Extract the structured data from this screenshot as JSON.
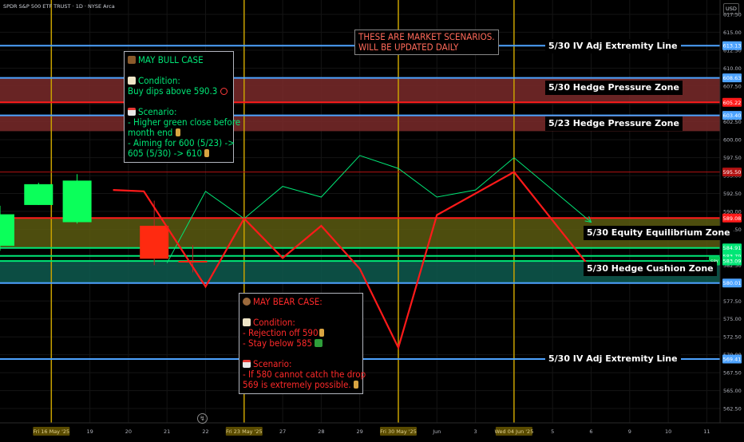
{
  "header": {
    "title": "SPDR S&P 500 ETF TRUST · 1D · NYSE Arca",
    "currency": "USD"
  },
  "colors": {
    "up": "#00e676",
    "down": "#ff1a1a",
    "blue_line": "#4da3ff",
    "gold_vline": "#c8a100",
    "zone_red": "#7a2a2a",
    "zone_olive": "#5a5a10",
    "zone_teal": "#0e5a4f"
  },
  "chart_data": {
    "type": "line",
    "ylim": [
      560.5,
      619.5
    ],
    "y_ticks": [
      617.5,
      615.0,
      612.5,
      610.0,
      607.5,
      605.0,
      602.5,
      600.0,
      597.5,
      595.0,
      592.5,
      590.0,
      587.5,
      585.0,
      582.5,
      580.0,
      577.5,
      575.0,
      572.5,
      570.0,
      567.5,
      565.0,
      562.5
    ],
    "y_tick_labels": [
      "617.50",
      "615.00",
      "612.50",
      "610.00",
      "607.50",
      "605.00",
      "602.50",
      "600.00",
      "597.50",
      "595.00",
      "592.50",
      "590.00",
      "587.50",
      "585.00",
      "582.50",
      "580.00",
      "577.50",
      "575.00",
      "572.50",
      "570.00",
      "567.50",
      "565.00",
      "562.50"
    ],
    "x_ticks": [
      {
        "i": 1,
        "label": "Fri 16 May '25",
        "highlight": true
      },
      {
        "i": 2,
        "label": "19"
      },
      {
        "i": 3,
        "label": "20"
      },
      {
        "i": 4,
        "label": "21"
      },
      {
        "i": 5,
        "label": "22"
      },
      {
        "i": 6,
        "label": "Fri 23 May '25",
        "highlight": true
      },
      {
        "i": 7,
        "label": "27"
      },
      {
        "i": 8,
        "label": "28"
      },
      {
        "i": 9,
        "label": "29"
      },
      {
        "i": 10,
        "label": "Fri 30 May '25",
        "highlight": true
      },
      {
        "i": 11,
        "label": "Jun"
      },
      {
        "i": 12,
        "label": "3"
      },
      {
        "i": 13,
        "label": "Wed 04 Jun '25",
        "highlight": true
      },
      {
        "i": 14,
        "label": "5"
      },
      {
        "i": 15,
        "label": "6"
      },
      {
        "i": 16,
        "label": "9"
      },
      {
        "i": 17,
        "label": "10"
      },
      {
        "i": 18,
        "label": "11"
      }
    ],
    "candles": [
      {
        "i": 0,
        "o": 585.2,
        "h": 590.8,
        "l": 584.5,
        "c": 589.6
      },
      {
        "i": 1,
        "o": 590.9,
        "h": 594.0,
        "l": 590.9,
        "c": 593.8
      },
      {
        "i": 2,
        "o": 588.5,
        "h": 595.2,
        "l": 588.3,
        "c": 594.3
      },
      {
        "i": 4,
        "o": 588.0,
        "h": 591.5,
        "l": 582.5,
        "c": 583.4
      },
      {
        "i": 5,
        "o": 583.1,
        "h": 585.3,
        "l": 581.5,
        "c": 582.9
      }
    ],
    "series": [
      {
        "color": "#00e676",
        "points": [
          [
            4.0,
            582.8
          ],
          [
            5.0,
            592.8
          ],
          [
            6.0,
            589.0
          ],
          [
            7.0,
            593.5
          ],
          [
            8.0,
            592.0
          ],
          [
            9.0,
            597.8
          ],
          [
            10.0,
            596.0
          ],
          [
            11.0,
            592.0
          ],
          [
            12.0,
            593.0
          ],
          [
            13.0,
            597.5
          ],
          [
            15.0,
            588.5
          ]
        ]
      },
      {
        "color": "#ff1a1a",
        "points": [
          [
            2.6,
            593.0
          ],
          [
            3.4,
            592.8
          ],
          [
            5.0,
            579.5
          ],
          [
            6.0,
            589.0
          ],
          [
            7.0,
            583.5
          ],
          [
            8.0,
            588.0
          ],
          [
            9.0,
            582.0
          ],
          [
            10.0,
            571.0
          ],
          [
            11.0,
            589.5
          ],
          [
            13.0,
            595.5
          ],
          [
            15.0,
            582.0
          ]
        ]
      }
    ],
    "zones": [
      {
        "top": 608.6,
        "bottom": 605.2,
        "color": "#7a2a2a"
      },
      {
        "top": 603.4,
        "bottom": 601.2,
        "color": "#7a2a2a"
      },
      {
        "top": 589.08,
        "bottom": 584.91,
        "color": "#5a5a10"
      },
      {
        "top": 583.09,
        "bottom": 580.01,
        "color": "#0e5a4f"
      }
    ],
    "hlines": [
      {
        "y": 613.13,
        "color": "#4da3ff",
        "tag": "613.13"
      },
      {
        "y": 608.63,
        "color": "#4da3ff",
        "tag": "608.63"
      },
      {
        "y": 605.22,
        "color": "#ff1a1a",
        "tag": "605.22"
      },
      {
        "y": 603.4,
        "color": "#4da3ff",
        "tag": "603.40"
      },
      {
        "y": 595.5,
        "color": "#b31212",
        "tag": "595.50",
        "thin": true
      },
      {
        "y": 589.08,
        "color": "#ff1a1a",
        "tag": "589.08"
      },
      {
        "y": 584.91,
        "color": "#00e676",
        "tag": "584.91"
      },
      {
        "y": 583.79,
        "color": "#00e676",
        "tag": "583.79"
      },
      {
        "y": 583.09,
        "color": "#00e676",
        "tag": "583.09"
      },
      {
        "y": 580.01,
        "color": "#4da3ff",
        "tag": "580.01"
      },
      {
        "y": 569.41,
        "color": "#4da3ff",
        "tag": "569.41"
      }
    ],
    "labels": [
      {
        "text": "5/30 IV Adj Extremity Line",
        "y": 613.0
      },
      {
        "text": "5/30 Hedge Pressure Zone",
        "y": 607.3
      },
      {
        "text": "5/23 Hedge Pressure Zone",
        "y": 602.3
      },
      {
        "text": "5/30 Equity Equilibrium Zone",
        "y": 587.0
      },
      {
        "text": "5/30 Hedge Cushion Zone",
        "y": 582.0
      },
      {
        "text": "5/30 IV Adj Extremity Line",
        "y": 569.4
      }
    ],
    "spy_tag": "SPY"
  },
  "annotations": {
    "scenario_note": [
      "THESE ARE MARKET SCENARIOS.",
      "WILL BE UPDATED DAILY"
    ],
    "bull": {
      "icon": "bull-icon",
      "title": "MAY BULL CASE",
      "lines": [
        "Condition:",
        "Buy dips above 590.3",
        "",
        "Scenario:",
        "- Higher green close before",
        "month end",
        "- Aiming for 600 (5/23) ->",
        "605 (5/30) -> 610"
      ]
    },
    "bear": {
      "icon": "bear-icon",
      "title": "MAY BEAR CASE:",
      "lines": [
        "Condition:",
        "- Rejection off 590",
        "- Stay below 585",
        "",
        "Scenario:",
        "- If 580 cannot catch the drop",
        "569 is extremely possible."
      ]
    }
  }
}
